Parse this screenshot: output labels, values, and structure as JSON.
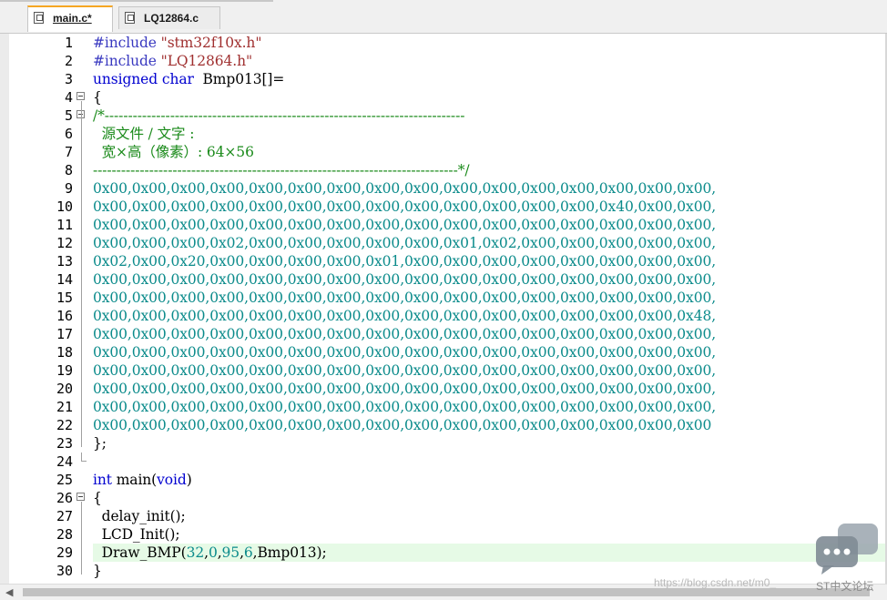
{
  "tabs": [
    {
      "label": "main.c*",
      "active": true
    },
    {
      "label": "LQ12864.c",
      "active": false
    }
  ],
  "current_line": 29,
  "lines": [
    {
      "n": "1",
      "segs": [
        [
          "pp",
          "#include "
        ],
        [
          "str",
          "\"stm32f10x.h\""
        ]
      ]
    },
    {
      "n": "2",
      "segs": [
        [
          "pp",
          "#include "
        ],
        [
          "str",
          "\"LQ12864.h\""
        ]
      ]
    },
    {
      "n": "3",
      "segs": [
        [
          "kw",
          "unsigned char"
        ],
        [
          "t",
          "  Bmp013[]="
        ]
      ]
    },
    {
      "n": "4",
      "segs": [
        [
          "t",
          "{"
        ]
      ]
    },
    {
      "n": "5",
      "segs": [
        [
          "cmt",
          "/*-----------------------------------------------------------------------------"
        ]
      ]
    },
    {
      "n": "6",
      "segs": [
        [
          "cmt",
          "  源文件 / 文字 :"
        ]
      ]
    },
    {
      "n": "7",
      "segs": [
        [
          "cmt",
          "  宽×高（像素）: 64×56"
        ]
      ]
    },
    {
      "n": "8",
      "segs": [
        [
          "cmt",
          "------------------------------------------------------------------------------*/"
        ]
      ]
    },
    {
      "n": "9",
      "hex": "0x00,0x00,0x00,0x00,0x00,0x00,0x00,0x00,0x00,0x00,0x00,0x00,0x00,0x00,0x00,0x00,"
    },
    {
      "n": "10",
      "hex": "0x00,0x00,0x00,0x00,0x00,0x00,0x00,0x00,0x00,0x00,0x00,0x00,0x00,0x40,0x00,0x00,"
    },
    {
      "n": "11",
      "hex": "0x00,0x00,0x00,0x00,0x00,0x00,0x00,0x00,0x00,0x00,0x00,0x00,0x00,0x00,0x00,0x00,"
    },
    {
      "n": "12",
      "hex": "0x00,0x00,0x00,0x02,0x00,0x00,0x00,0x00,0x00,0x01,0x02,0x00,0x00,0x00,0x00,0x00,"
    },
    {
      "n": "13",
      "hex": "0x02,0x00,0x20,0x00,0x00,0x00,0x00,0x01,0x00,0x00,0x00,0x00,0x00,0x00,0x00,0x00,"
    },
    {
      "n": "14",
      "hex": "0x00,0x00,0x00,0x00,0x00,0x00,0x00,0x00,0x00,0x00,0x00,0x00,0x00,0x00,0x00,0x00,"
    },
    {
      "n": "15",
      "hex": "0x00,0x00,0x00,0x00,0x00,0x00,0x00,0x00,0x00,0x00,0x00,0x00,0x00,0x00,0x00,0x00,"
    },
    {
      "n": "16",
      "hex": "0x00,0x00,0x00,0x00,0x00,0x00,0x00,0x00,0x00,0x00,0x00,0x00,0x00,0x00,0x00,0x48,"
    },
    {
      "n": "17",
      "hex": "0x00,0x00,0x00,0x00,0x00,0x00,0x00,0x00,0x00,0x00,0x00,0x00,0x00,0x00,0x00,0x00,"
    },
    {
      "n": "18",
      "hex": "0x00,0x00,0x00,0x00,0x00,0x00,0x00,0x00,0x00,0x00,0x00,0x00,0x00,0x00,0x00,0x00,"
    },
    {
      "n": "19",
      "hex": "0x00,0x00,0x00,0x00,0x00,0x00,0x00,0x00,0x00,0x00,0x00,0x00,0x00,0x00,0x00,0x00,"
    },
    {
      "n": "20",
      "hex": "0x00,0x00,0x00,0x00,0x00,0x00,0x00,0x00,0x00,0x00,0x00,0x00,0x00,0x00,0x00,0x00,"
    },
    {
      "n": "21",
      "hex": "0x00,0x00,0x00,0x00,0x00,0x00,0x00,0x00,0x00,0x00,0x00,0x00,0x00,0x00,0x00,0x00,"
    },
    {
      "n": "22",
      "hex": "0x00,0x00,0x00,0x00,0x00,0x00,0x00,0x00,0x00,0x00,0x00,0x00,0x00,0x00,0x00,0x00"
    },
    {
      "n": "23",
      "segs": [
        [
          "t",
          "};"
        ]
      ]
    },
    {
      "n": "24",
      "segs": []
    },
    {
      "n": "25",
      "segs": [
        [
          "kw",
          "int"
        ],
        [
          "t",
          " main("
        ],
        [
          "kw",
          "void"
        ],
        [
          "t",
          ")"
        ]
      ]
    },
    {
      "n": "26",
      "segs": [
        [
          "t",
          "{"
        ]
      ]
    },
    {
      "n": "27",
      "segs": [
        [
          "t",
          "  delay_init();"
        ]
      ]
    },
    {
      "n": "28",
      "segs": [
        [
          "t",
          "  LCD_Init();"
        ]
      ]
    },
    {
      "n": "29",
      "segs": [
        [
          "t",
          "  Draw_BMP("
        ],
        [
          "num",
          "32"
        ],
        [
          "t",
          ","
        ],
        [
          "num",
          "0"
        ],
        [
          "t",
          ","
        ],
        [
          "num",
          "95"
        ],
        [
          "t",
          ","
        ],
        [
          "num",
          "6"
        ],
        [
          "t",
          ",Bmp013);"
        ]
      ]
    },
    {
      "n": "30",
      "segs": [
        [
          "t",
          "}"
        ]
      ]
    }
  ],
  "folds": {
    "open": [
      "4",
      "5",
      "26"
    ],
    "end": [
      "24"
    ]
  },
  "watermark": {
    "url_text": "https://blog.csdn.net/m0_",
    "brand_text": "ST中文论坛",
    "icon": "chat-bubble-icon"
  },
  "colors": {
    "current_line_bg": "#e6fae6",
    "active_tab_accent": "#f5a623",
    "number": "#0b8b8b",
    "comment": "#1a8a1a",
    "keyword": "#0000d0",
    "string": "#a03030"
  }
}
